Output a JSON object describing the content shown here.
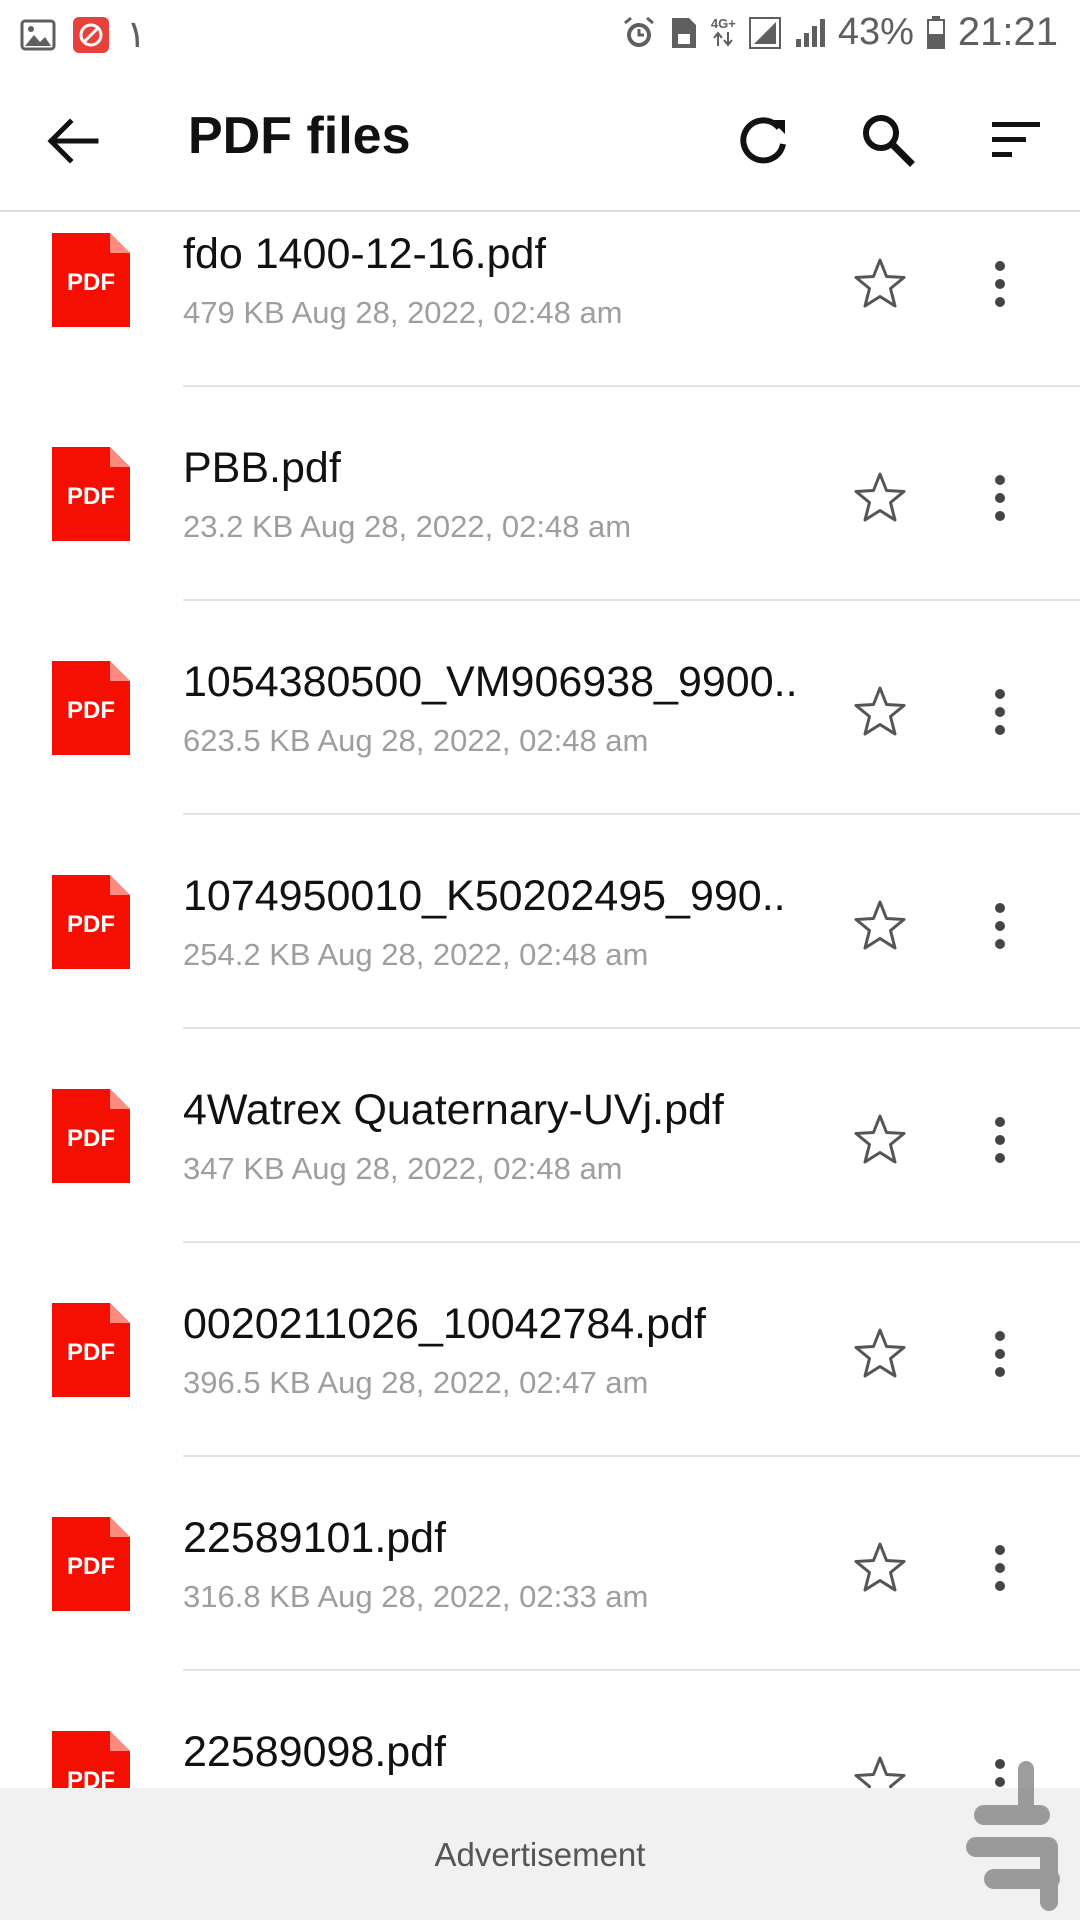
{
  "statusbar": {
    "left_extra": "١",
    "network": "4G+",
    "battery": "43%",
    "time": "21:21"
  },
  "appbar": {
    "title": "PDF files",
    "icons": [
      "back-arrow-icon",
      "refresh-icon",
      "search-icon",
      "sort-icon"
    ]
  },
  "files": [
    {
      "name": "fdo 1400-12-16.pdf",
      "meta": "479 KB Aug 28, 2022, 02:48 am"
    },
    {
      "name": "PBB.pdf",
      "meta": "23.2 KB Aug 28, 2022, 02:48 am"
    },
    {
      "name": "1054380500_VM906938_9900..",
      "meta": "623.5 KB Aug 28, 2022, 02:48 am"
    },
    {
      "name": "1074950010_K50202495_990..",
      "meta": "254.2 KB Aug 28, 2022, 02:48 am"
    },
    {
      "name": "4Watrex Quaternary-UVj.pdf",
      "meta": "347 KB Aug 28, 2022, 02:48 am"
    },
    {
      "name": "0020211026_10042784.pdf",
      "meta": "396.5 KB Aug 28, 2022, 02:47 am"
    },
    {
      "name": "22589101.pdf",
      "meta": "316.8 KB Aug 28, 2022, 02:33 am"
    },
    {
      "name": "22589098.pdf",
      "meta": ""
    }
  ],
  "pdf_badge": "PDF",
  "ad": {
    "label": "Advertisement"
  },
  "colors": {
    "pdf_red": "#f40f02",
    "divider": "#e3e3e3",
    "meta_gray": "#9e9e9e"
  }
}
